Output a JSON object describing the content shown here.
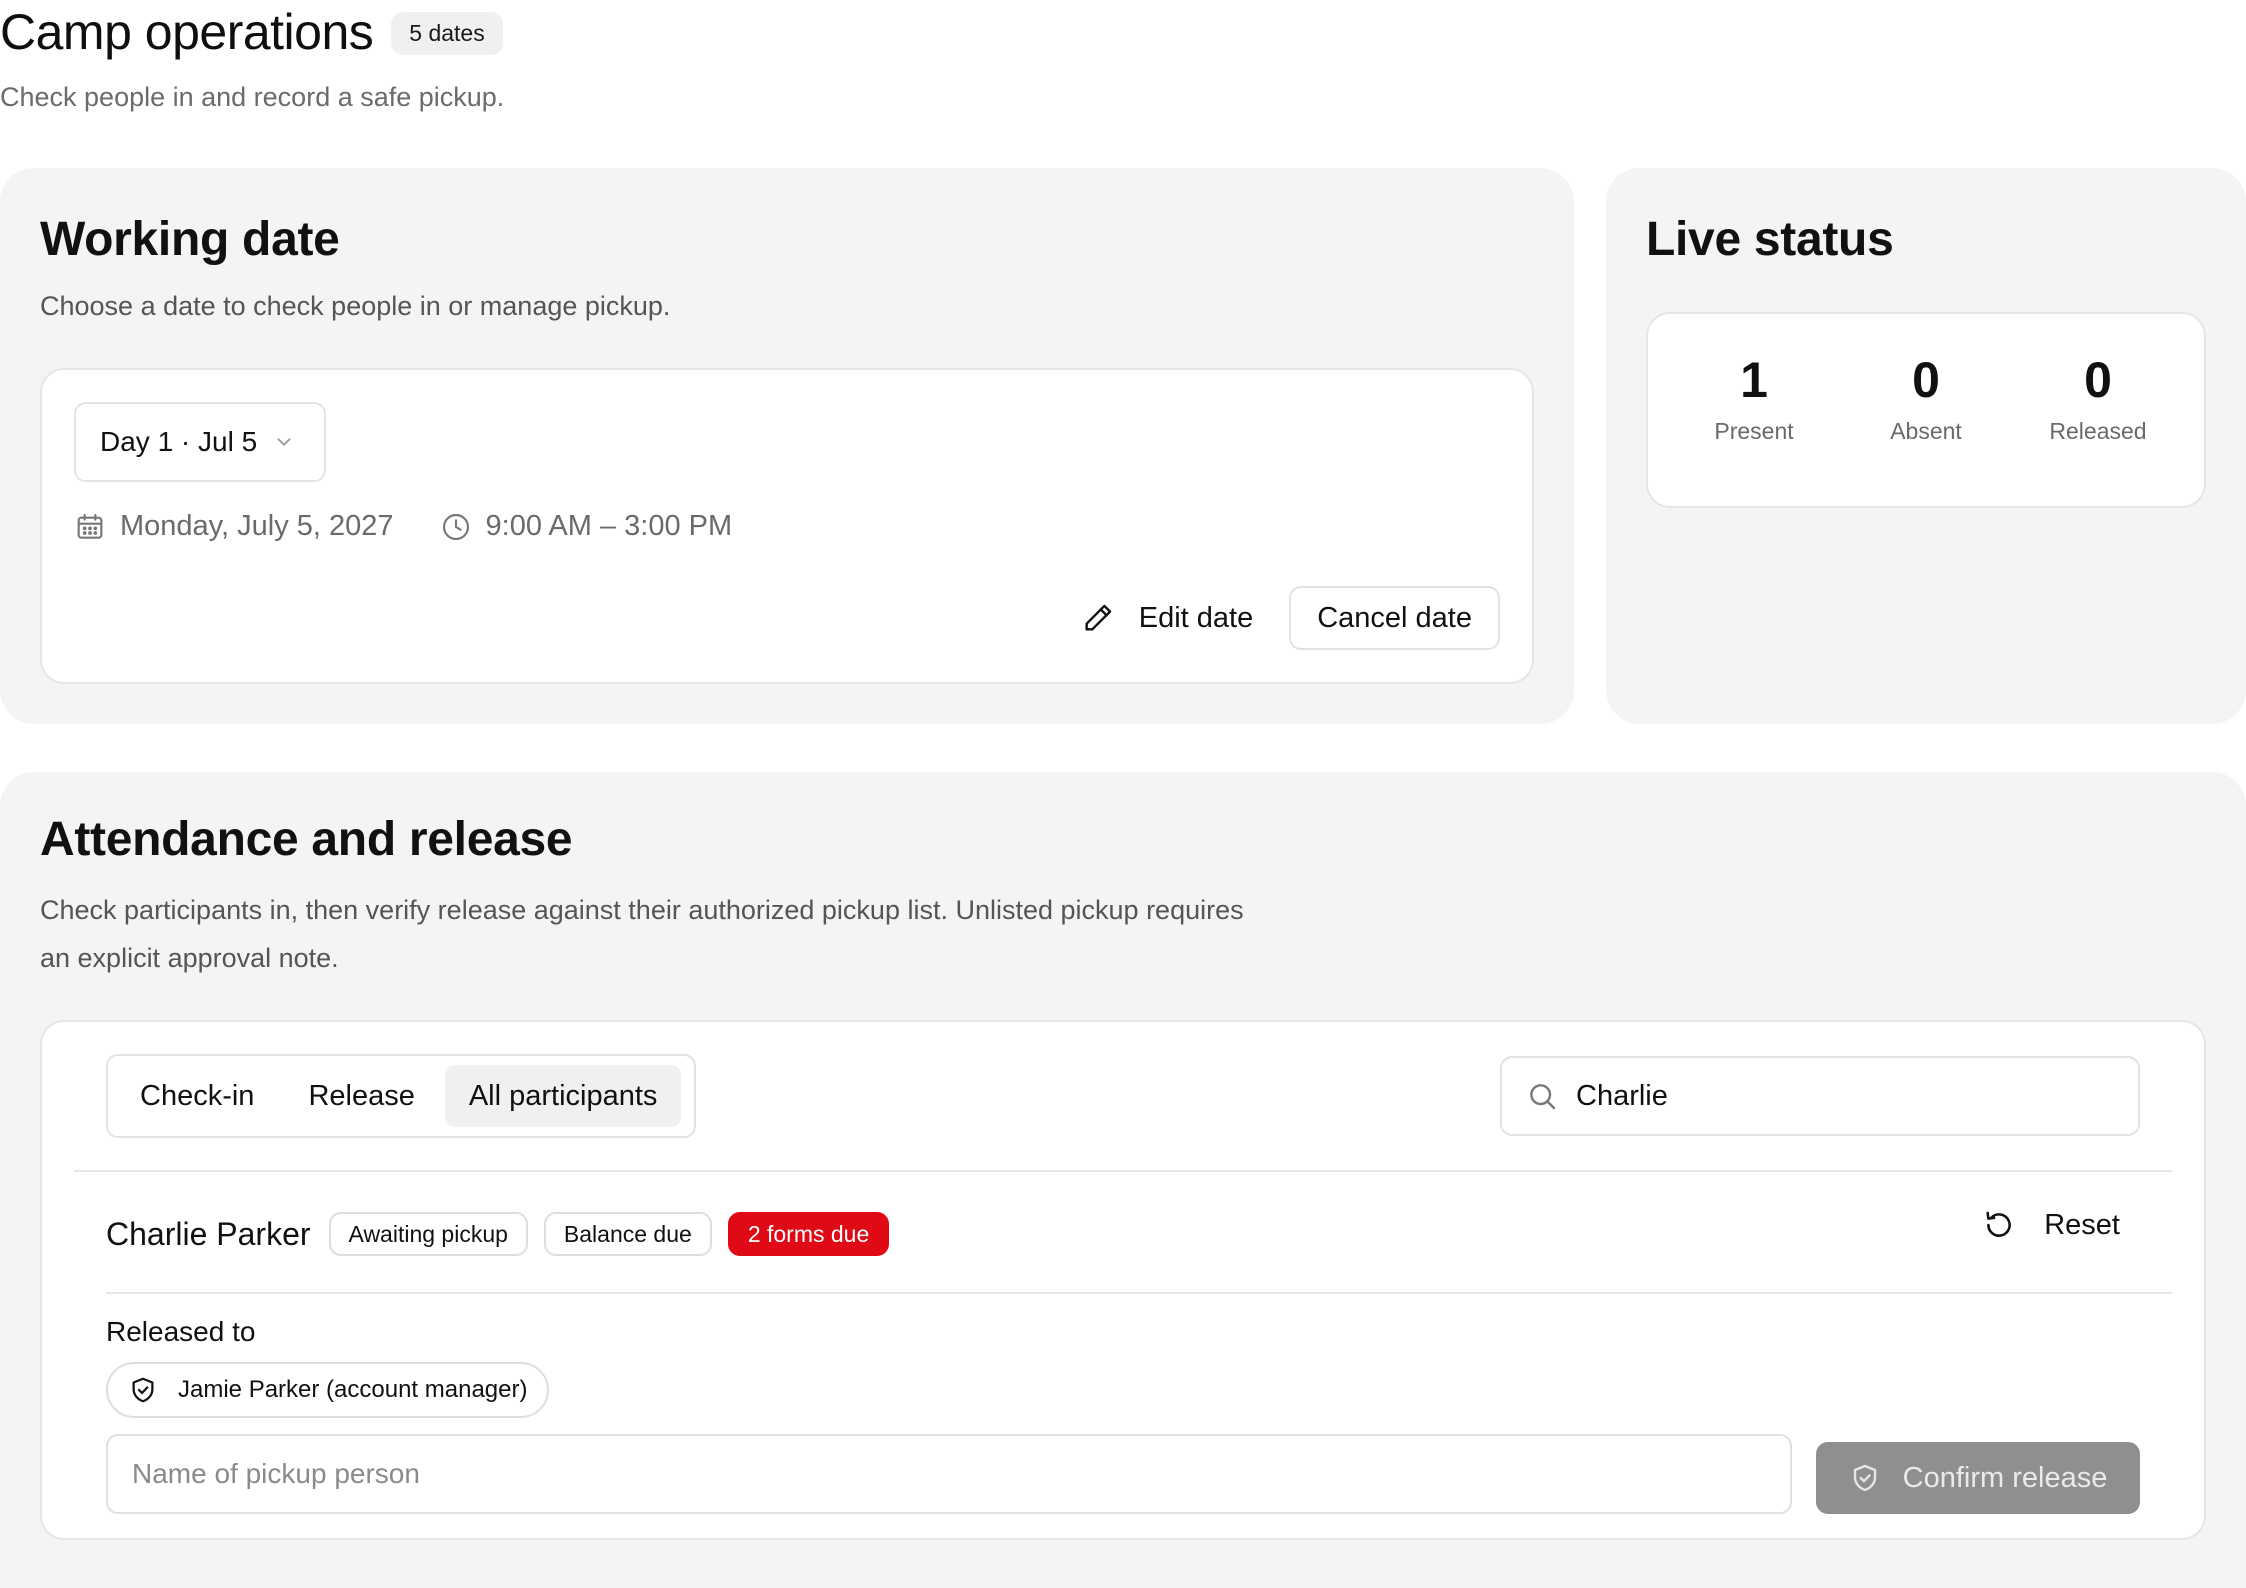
{
  "header": {
    "title": "Camp operations",
    "date_count": "5 dates",
    "subtitle": "Check people in and record a safe pickup."
  },
  "working_date": {
    "title": "Working date",
    "description": "Choose a date to check people in or manage pickup.",
    "selected_date": "Day 1 · Jul 5",
    "full_date": "Monday, July 5, 2027",
    "time_range": "9:00 AM – 3:00 PM",
    "edit_label": "Edit date",
    "cancel_label": "Cancel date"
  },
  "live_status": {
    "title": "Live status",
    "stats": [
      {
        "value": "1",
        "label": "Present"
      },
      {
        "value": "0",
        "label": "Absent"
      },
      {
        "value": "0",
        "label": "Released"
      }
    ]
  },
  "attendance": {
    "title": "Attendance and release",
    "description_line1": "Check participants in, then verify release against their authorized pickup list. Unlisted pickup requires",
    "description_line2": "an explicit approval note.",
    "tabs": [
      {
        "label": "Check-in",
        "active": false
      },
      {
        "label": "Release",
        "active": false
      },
      {
        "label": "All participants",
        "active": true
      }
    ],
    "search_value": "Charlie",
    "participant": {
      "name": "Charlie Parker",
      "chips": [
        "Awaiting pickup",
        "Balance due",
        "2 forms due"
      ],
      "reset_label": "Reset",
      "released_to_label": "Released to",
      "authorized_pickup": "Jamie Parker (account manager)",
      "pickup_placeholder": "Name of pickup person",
      "confirm_label": "Confirm release"
    }
  },
  "colors": {
    "panel_bg": "#f4f4f4",
    "alert_red": "#e00a16",
    "disabled_button": "#8f8f8f"
  }
}
